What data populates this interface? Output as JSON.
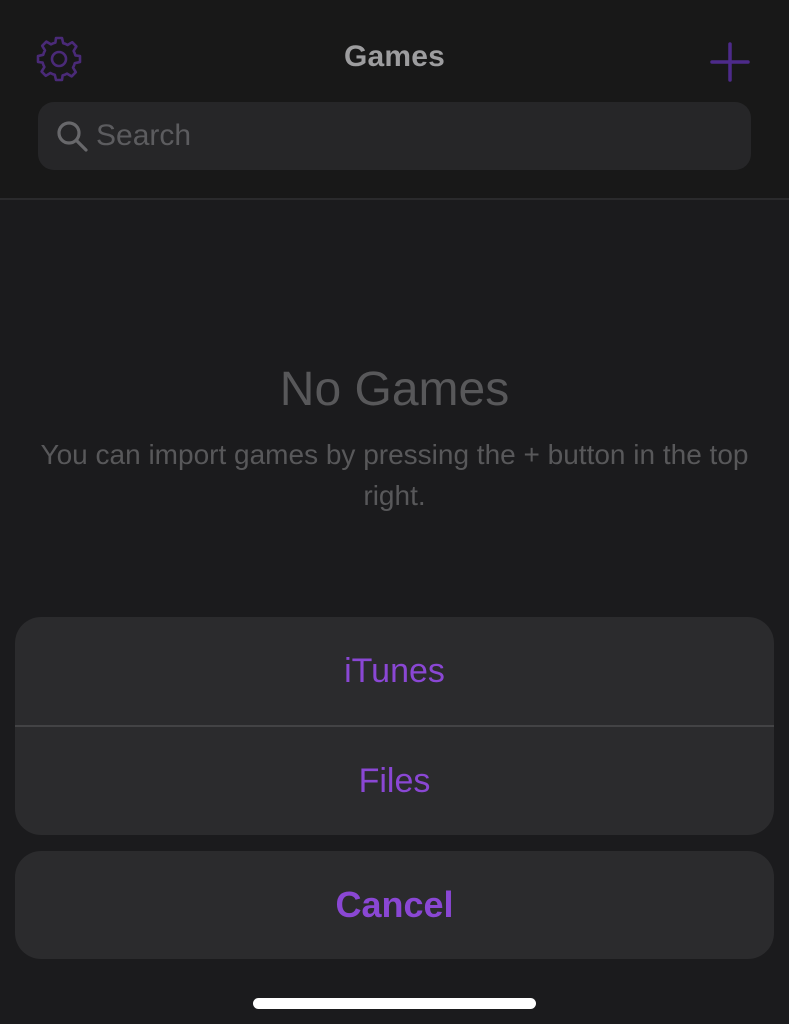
{
  "navbar": {
    "title": "Games",
    "settings_icon": "gear-icon",
    "add_icon": "plus-icon"
  },
  "search": {
    "placeholder": "Search",
    "icon": "search-icon"
  },
  "empty_state": {
    "title": "No Games",
    "description": "You can import games by pressing the + button in the top right."
  },
  "action_sheet": {
    "options": [
      {
        "label": "iTunes"
      },
      {
        "label": "Files"
      }
    ],
    "cancel_label": "Cancel"
  },
  "colors": {
    "accent": "#8a47d4",
    "background": "#1b1b1d",
    "sheet_background": "#2b2b2d",
    "muted_text": "#58585a"
  }
}
